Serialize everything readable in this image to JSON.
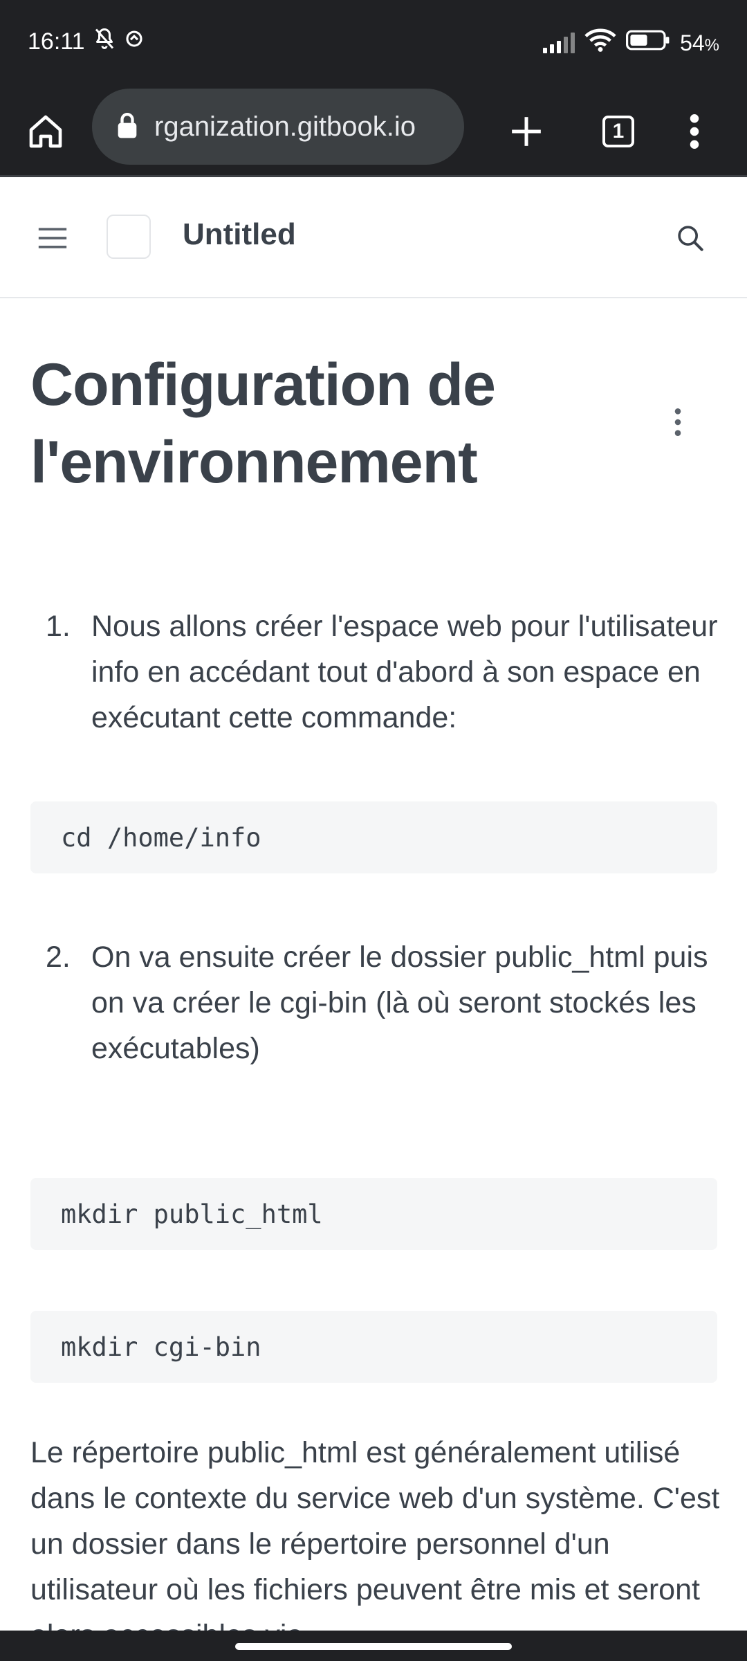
{
  "status_bar": {
    "time": "16:11",
    "battery": "54",
    "battery_unit": "%",
    "battery_level": 0.54,
    "icons": [
      "muted-bell-icon",
      "sync-icon",
      "signal-icon",
      "wifi-icon",
      "battery-icon"
    ]
  },
  "browser": {
    "url": "rganization.gitbook.io",
    "tab_count": "1",
    "icons": [
      "home-icon",
      "lock-icon",
      "plus-icon",
      "tab-switcher-icon",
      "more-vertical-icon"
    ]
  },
  "site": {
    "title": "Untitled",
    "icons": [
      "hamburger-menu-icon",
      "search-icon"
    ]
  },
  "page": {
    "title": "Configuration de l'environnement",
    "items": [
      {
        "number": "1.",
        "text": "Nous allons créer l'espace web pour l'utilisateur info en accédant tout d'abord à son espace en exécutant cette commande:"
      },
      {
        "number": "2.",
        "text": "On va ensuite créer le dossier public_html puis on va créer le cgi-bin (là où seront stockés les exécutables)"
      }
    ],
    "code_blocks": [
      "cd /home/info",
      "mkdir public_html",
      "mkdir cgi-bin"
    ],
    "paragraph": "Le répertoire public_html est généralement utilisé dans le contexte du service web d'un système. C'est un dossier dans le répertoire personnel d'un utilisateur où les fichiers peuvent être mis et seront alors accessibles via"
  },
  "colors": {
    "chrome_bg": "#202124",
    "url_pill_bg": "#3c4043",
    "text": "#3a414a",
    "code_bg": "#f5f6f7"
  }
}
